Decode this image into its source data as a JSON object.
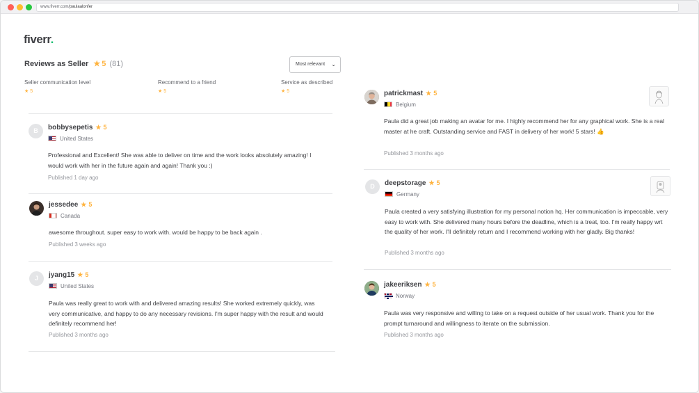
{
  "browser": {
    "url_prefix": "www.fiverr.com/",
    "url_path": "paulaalonfer"
  },
  "logo": {
    "text": "fiverr",
    "dot": "."
  },
  "reviews_header": {
    "title": "Reviews as Seller",
    "score": "5",
    "count": "(81)"
  },
  "sort": {
    "selected": "Most relevant"
  },
  "criteria": [
    {
      "label": "Seller communication level",
      "value": "5"
    },
    {
      "label": "Recommend to a friend",
      "value": "5"
    },
    {
      "label": "Service as described",
      "value": "5"
    }
  ],
  "reviews_left": [
    {
      "initial": "B",
      "name": "bobbysepetis",
      "rating": "5",
      "country": "United States",
      "text": "Professional and Excellent! She was able to deliver on time and the work looks absolutely amazing! I would work with her in the future again and again! Thank you :)",
      "published": "Published 1 day ago"
    },
    {
      "initial": "",
      "name": "jessedee",
      "rating": "5",
      "country": "Canada",
      "text": "awesome throughout. super easy to work with. would be happy to be back again .",
      "published": "Published 3 weeks ago"
    },
    {
      "initial": "J",
      "name": "jyang15",
      "rating": "5",
      "country": "United States",
      "text": "Paula was really great to work with and delivered amazing results! She worked extremely quickly, was very communicative, and happy to do any necessary revisions. I'm super happy with the result and would definitely recommend her!",
      "published": "Published 3 months ago"
    }
  ],
  "reviews_right": [
    {
      "initial": "",
      "name": "patrickmast",
      "rating": "5",
      "country": "Belgium",
      "text": "Paula did a great job making an avatar for me. I highly recommend her for any graphical work. She is a real master at he craft. Outstanding service and FAST in delivery of her work! 5 stars! 👍",
      "published": "Published 3 months ago"
    },
    {
      "initial": "D",
      "name": "deepstorage",
      "rating": "5",
      "country": "Germany",
      "text": "Paula created a very satisfying illustration for my personal notion hq. Her communication is impeccable, very easy to work with. She delivered many hours before the deadline, which is a treat, too. I'm really happy wrt the quality of her work. I'll definitely return and I recommend working with her gladly. Big thanks!",
      "published": "Published 3 months ago"
    },
    {
      "initial": "",
      "name": "jakeeriksen",
      "rating": "5",
      "country": "Norway",
      "text": "Paula was very responsive and willing to take on a request outside of her usual work. Thank you for the prompt turnaround and willingness to iterate on the submission.",
      "published": "Published 3 months ago"
    }
  ],
  "colors": {
    "star": "#ffb33e",
    "brand_green": "#1dbf73",
    "text": "#404145",
    "muted": "#95979d"
  }
}
